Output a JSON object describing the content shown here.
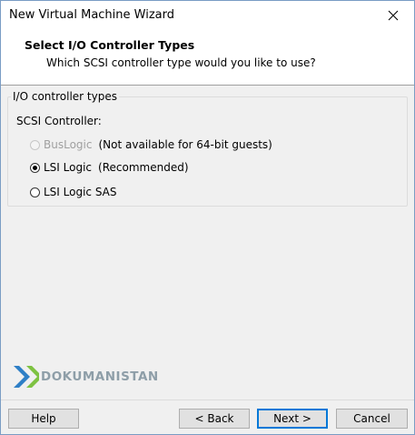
{
  "window": {
    "title": "New Virtual Machine Wizard",
    "close_icon": "close-icon"
  },
  "header": {
    "title": "Select I/O Controller Types",
    "subtitle": "Which SCSI controller type would you like to use?"
  },
  "group": {
    "legend": "I/O controller types",
    "scsi_label": "SCSI Controller:",
    "options": [
      {
        "label": "BusLogic",
        "note": "(Not available for 64-bit guests)",
        "checked": false,
        "disabled": true
      },
      {
        "label": "LSI Logic",
        "note": "(Recommended)",
        "checked": true,
        "disabled": false
      },
      {
        "label": "LSI Logic SAS",
        "note": "",
        "checked": false,
        "disabled": false
      }
    ]
  },
  "watermark": {
    "text": "DOKUMANISTAN",
    "icon": "dokumanistan-logo-icon",
    "colors": {
      "blue": "#2e7fc6",
      "green": "#7ec242",
      "text": "#8e9ea8"
    }
  },
  "buttons": {
    "help": "Help",
    "back": "< Back",
    "next": "Next >",
    "cancel": "Cancel"
  },
  "colors": {
    "dialog_bg": "#f0f0f0",
    "header_bg": "#ffffff",
    "default_button_border": "#0078d7"
  }
}
